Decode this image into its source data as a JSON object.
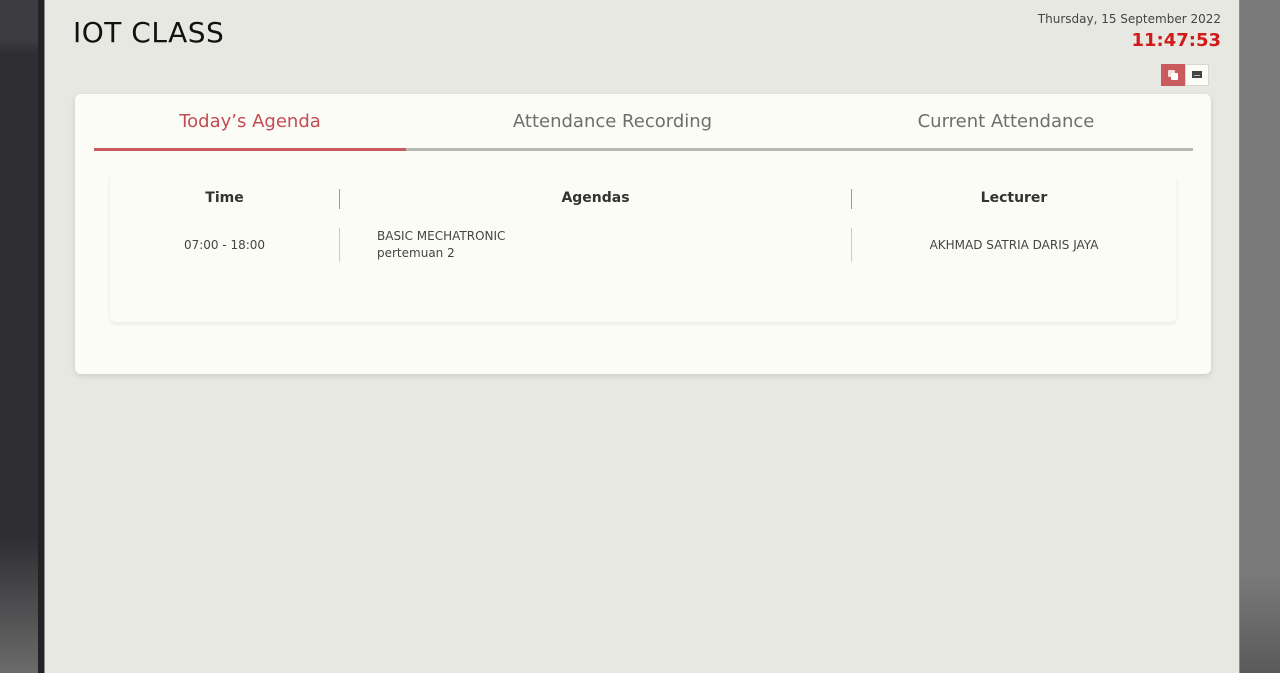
{
  "header": {
    "title": "IOT CLASS",
    "date": "Thursday, 15 September 2022",
    "time": "11:47:53"
  },
  "view_toggle": {
    "buttons": [
      {
        "icon": "copy-icon",
        "active": true
      },
      {
        "icon": "monitor-icon",
        "active": false
      }
    ]
  },
  "colors": {
    "accent": "#c95a5d",
    "time": "#d11a1a",
    "background": "#e7e8e2",
    "card": "#fcfcf6"
  },
  "tabs": [
    {
      "label": "Today’s Agenda",
      "active": true
    },
    {
      "label": "Attendance Recording",
      "active": false
    },
    {
      "label": "Current Attendance",
      "active": false
    }
  ],
  "agenda_table": {
    "headers": [
      "Time",
      "Agendas",
      "Lecturer"
    ],
    "rows": [
      {
        "time": "07:00 - 18:00",
        "agenda_title": "BASIC MECHATRONIC",
        "agenda_subtitle": "pertemuan 2",
        "lecturer": "AKHMAD SATRIA DARIS JAYA"
      }
    ]
  }
}
